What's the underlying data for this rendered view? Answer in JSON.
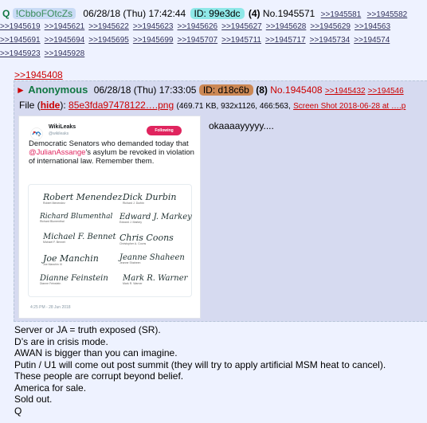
{
  "header": {
    "q_letter": "Q",
    "tripcode": "!CbboFOtcZs",
    "datetime": "06/28/18 (Thu) 17:42:44",
    "id_label": "ID: 99e3dc",
    "reply_count": "(4)",
    "post_no": "No.1945571",
    "inline_links": [
      ">>1945581",
      ">>1945582"
    ]
  },
  "backlinks_rows": [
    [
      ">>1945619",
      ">>1945621",
      ">>1945622",
      ">>1945623",
      ">>1945626",
      ">>1945627",
      ">>1945628",
      ">>1945629",
      ">>194563"
    ],
    [
      ">>1945691",
      ">>1945694",
      ">>1945695",
      ">>1945699",
      ">>1945707",
      ">>1945711",
      ">>1945717",
      ">>1945734",
      ">>194574"
    ],
    [
      ">>1945923",
      ">>1945928"
    ]
  ],
  "quote_link": ">>1945408",
  "reply": {
    "name": "Anonymous",
    "datetime": "06/28/18 (Thu) 17:33:05",
    "id_label": "ID: d18c6b",
    "reply_count": "(8)",
    "post_no": "No.1945408",
    "links": [
      ">>1945432",
      ">>194546"
    ],
    "file_label": "File",
    "hide_label": "hide",
    "file_name": "85e3fda97478122….png",
    "file_meta": "(469.71 KB, 932x1126, 466:563,",
    "original_name": "Screen Shot 2018-06-28 at ….p",
    "comment": "okaaaayyyyy....",
    "tweet": {
      "name": "WikiLeaks",
      "handle": "@wikileaks",
      "follow_label": "Following",
      "text_before": "Democratic Senators who demanded today that ",
      "mention": "@JulianAssange",
      "text_after": "'s asylum be revoked in violation of international law. Remember them.",
      "timestamp": "4:25 PM - 28 Jun 2018",
      "signatures": [
        {
          "sig": "Robert Menendez",
          "printed": "Robert Menendez"
        },
        {
          "sig": "Dick Durbin",
          "printed": "Richard J. Durbin"
        },
        {
          "sig": "Richard Blumenthal",
          "printed": "Richard Blumenthal"
        },
        {
          "sig": "Edward J. Markey",
          "printed": "Edward J. Markey"
        },
        {
          "sig": "Michael F. Bennet",
          "printed": "Michael F. Bennet"
        },
        {
          "sig": "Chris Coons",
          "printed": "Christopher A. Coons"
        },
        {
          "sig": "Joe Manchin",
          "printed": "Joe Manchin III"
        },
        {
          "sig": "Jeanne Shaheen",
          "printed": "Jeanne Shaheen"
        },
        {
          "sig": "Dianne Feinstein",
          "printed": "Dianne Feinstein"
        },
        {
          "sig": "Mark R. Warner",
          "printed": "Mark R. Warner"
        }
      ]
    }
  },
  "body_lines": [
    "Server or JA = truth exposed (SR).",
    "D’s are in crisis mode.",
    "AWAN is bigger than you can imagine.",
    "Putin / U1 will come out post summit (they will try to apply artificial MSM heat to cancel).",
    "These people are corrupt beyond belief.",
    "America for sale.",
    "Sold out.",
    "Q"
  ]
}
